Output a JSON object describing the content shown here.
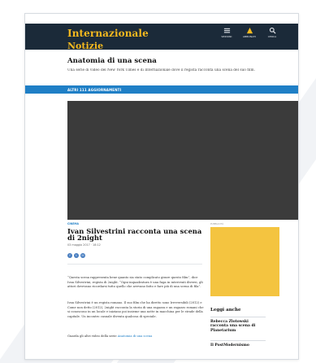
{
  "header": {
    "brand": "Internazionale",
    "section": "Notizie",
    "nav": [
      {
        "icon": "grid-icon",
        "label": "SEZIONI"
      },
      {
        "icon": "user-icon",
        "label": "ABBONATI"
      },
      {
        "icon": "search-icon",
        "label": "CERCA"
      }
    ]
  },
  "page": {
    "heading": "Anatomia di una scena",
    "subtitle": "Una serie di video del New York Times e di Internazionale dove il regista racconta una scena del suo film."
  },
  "updates": {
    "label": "ALTRI 111 AGGIORNAMENTI"
  },
  "article": {
    "kicker": "CINEMA",
    "title": "Ivan Silvestrini racconta una scena di 2night",
    "dateline": "03 maggio 2017 · 18:12",
    "share": [
      "f",
      "t",
      "✉"
    ],
    "paragraphs": [
      "“Questa scena rappresenta bene quanto sia stato complicato girare questo film”, dice Ivan Silvestrini, regista di 2night. “Ogni inquadratura è una fuga in interventi diversi, gli attori dovevano ricordarsi tutto quello che avevano fatto e fare più di una scena di fila”.",
      "Ivan Silvestrini è un regista romano. Il suo film che ha diretto sono Irreversibili (2012) e Come non detto (2012), 2night racconta la storia di una ragazza e un ragazzo romani che si conoscono in un locale e iniziano poi insieme una notte in macchina per le strade della capitale. Un incontro casuale diventa qualcosa di speciale."
    ],
    "more_prefix": "Guarda gli altri video della serie",
    "more_link": "Anatomia di una scena"
  },
  "ad": {
    "label": "PUBBLICITÀ"
  },
  "related": {
    "title": "Leggi anche",
    "items": [
      "Rebecca Zlotowski racconta una scena di Planetarium",
      "Il PostModernismo"
    ]
  },
  "colors": {
    "topbar": "#1b2a39",
    "brand": "#f5b91f",
    "accent": "#1f7fc6",
    "ad": "#f4c440"
  }
}
